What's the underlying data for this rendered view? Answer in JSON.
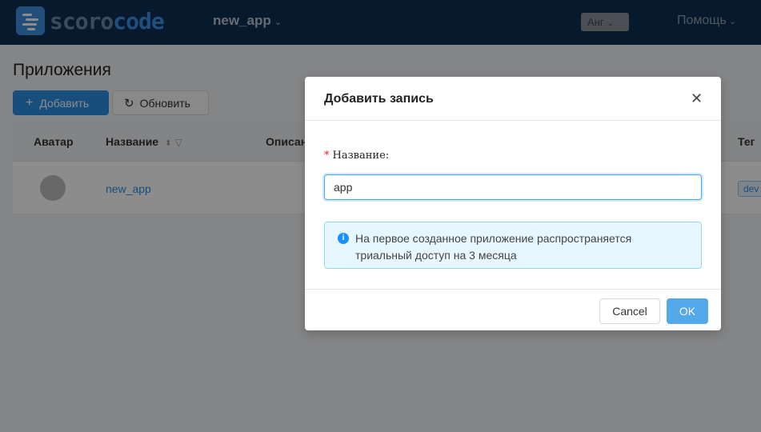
{
  "header": {
    "logo_part1": "scoro",
    "logo_part2": "code",
    "app_name": "new_app",
    "chevron": "⌄",
    "lang": "Анг",
    "help": "Помощь"
  },
  "page": {
    "title": "Приложения",
    "add_label": "Добавить",
    "refresh_label": "Обновить",
    "columns": {
      "avatar": "Аватар",
      "name": "Название",
      "description": "Описан",
      "tag": "Тег"
    },
    "rows": [
      {
        "name": "new_app",
        "tag": "dev"
      }
    ]
  },
  "modal": {
    "title": "Добавить запись",
    "field_label": "Название",
    "field_colon": ":",
    "field_value": "app",
    "alert_line1": "На первое созданное приложение распространяется",
    "alert_line2": "триальный доступ на 3 месяца",
    "cancel_label": "Cancel",
    "ok_label": "OK"
  },
  "icons": {
    "close": "close-icon",
    "info": "info-icon",
    "plus": "plus-icon",
    "refresh": "refresh-icon",
    "sort": "sort-icon",
    "filter": "filter-icon"
  },
  "colors": {
    "header_bg": "#0d2f52",
    "primary": "#2d8ee0",
    "ok_button": "#52a8e8",
    "alert_bg": "#e6f7ff"
  }
}
